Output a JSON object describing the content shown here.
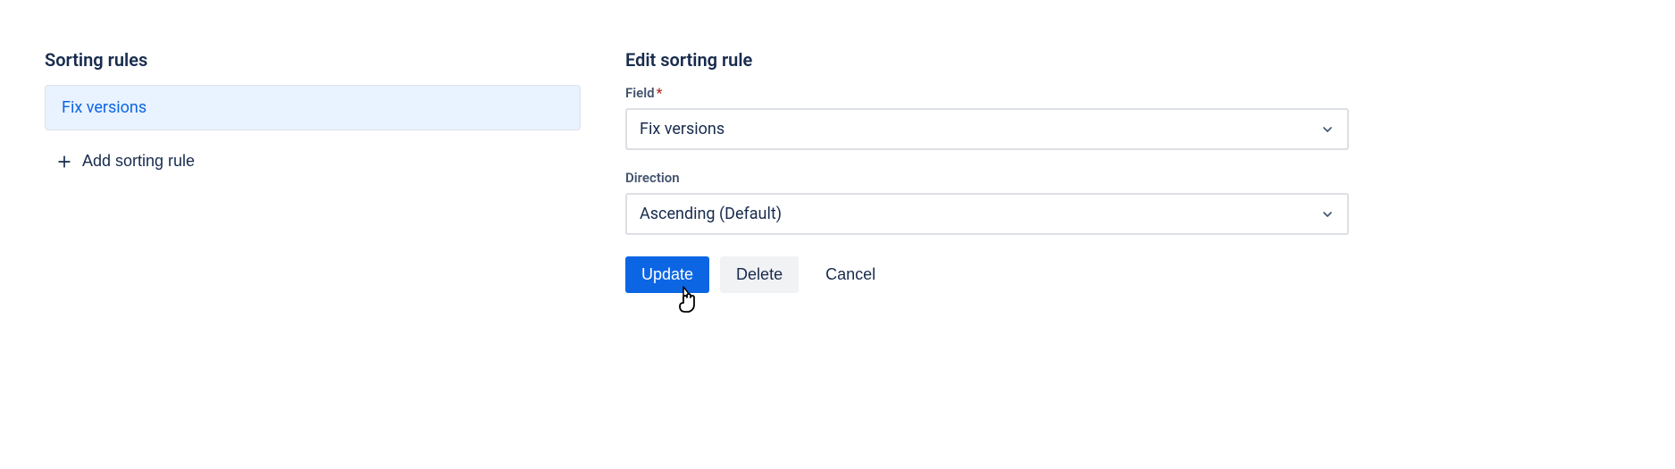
{
  "left": {
    "heading": "Sorting rules",
    "rules": [
      {
        "label": "Fix versions"
      }
    ],
    "add_label": "Add sorting rule"
  },
  "right": {
    "heading": "Edit sorting rule",
    "field_label": "Field",
    "field_value": "Fix versions",
    "direction_label": "Direction",
    "direction_value": "Ascending (Default)",
    "update_label": "Update",
    "delete_label": "Delete",
    "cancel_label": "Cancel"
  }
}
